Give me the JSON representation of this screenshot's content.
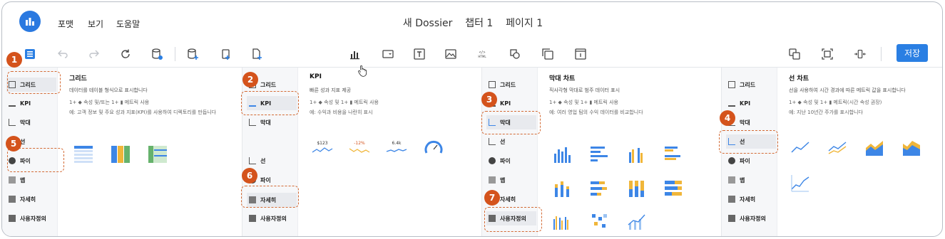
{
  "header": {
    "menus": [
      "포맷",
      "보기",
      "도움말"
    ],
    "title": "새 Dossier",
    "chapter": "챕터 1",
    "page": "페이지 1"
  },
  "toolbar": {
    "save": "저장"
  },
  "sidebar": {
    "grid": "그리드",
    "kpi": "KPI",
    "bar": "막대",
    "line": "선",
    "pie": "파이",
    "map": "맵",
    "detail": "자세히",
    "custom": "사용자정의"
  },
  "panels": [
    {
      "title": "그리드",
      "desc": "데이터를 테이블 형식으로 표시합니다",
      "req": "1+ ◆ 속성 및/또는 1+ ▮ 메트릭 사용",
      "ex": "예: 고객 정보 및 주요 성과 지표(KPI)를 사용하여 디렉토리를 만듭니다"
    },
    {
      "title": "KPI",
      "desc": "빠른 성과 지표 제공",
      "req": "1+ ◆ 속성 및 1+ ▮ 메트릭 사용",
      "ex": "예: 수익과 비용을 나란히 표시",
      "kpi_values": [
        "$123",
        "-12%",
        "6.4k"
      ]
    },
    {
      "title": "막대 차트",
      "desc": "직사각형 막대로 범주 데이터 표시",
      "req": "1+ ◆ 속성 및 1+ ▮ 메트릭 사용",
      "ex": "예: 여러 영업 팀의 수익 데이터를 비교합니다"
    },
    {
      "title": "선 차트",
      "desc": "선을 사용하여 시간 경과에 따른 메트릭 값을 표시합니다",
      "req": "1+ ◆ 속성 및 1+ ▮ 메트릭(시간 속성 권장)",
      "ex": "예: 지난 10년간 주가를 표시합니다"
    }
  ],
  "badges": [
    "1",
    "2",
    "3",
    "4",
    "5",
    "6",
    "7"
  ],
  "colors": {
    "accent": "#2a7fe3",
    "badge": "#d4531c",
    "dash": "#d36a34",
    "bar_blue": "#3d86e6",
    "bar_yellow": "#f0b63a",
    "bar_green": "#66b26c"
  }
}
